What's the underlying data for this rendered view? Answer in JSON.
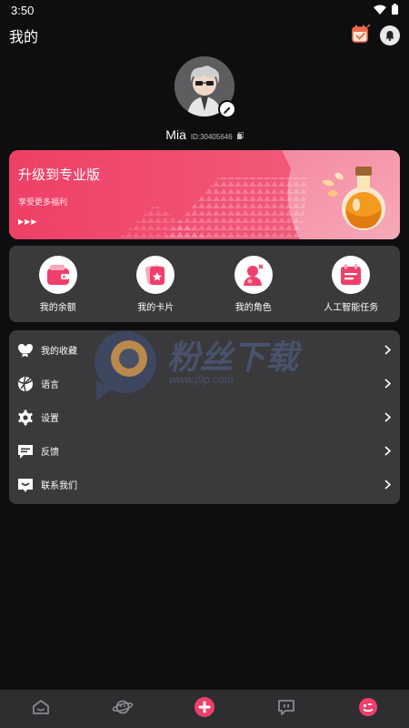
{
  "status_bar": {
    "time": "3:50"
  },
  "header": {
    "title": "我的"
  },
  "profile": {
    "name": "Mia",
    "id": "ID:30405646"
  },
  "pro_banner": {
    "title": "升级到专业版",
    "subtitle": "享受更多福利"
  },
  "quick_actions": [
    {
      "label": "我的余额",
      "icon": "wallet-icon"
    },
    {
      "label": "我的卡片",
      "icon": "card-icon"
    },
    {
      "label": "我的角色",
      "icon": "character-icon"
    },
    {
      "label": "人工智能任务",
      "icon": "calendar-task-icon"
    }
  ],
  "menu": [
    {
      "label": "我的收藏",
      "icon": "favorites-icon"
    },
    {
      "label": "语言",
      "icon": "language-icon"
    },
    {
      "label": "设置",
      "icon": "gear-icon"
    },
    {
      "label": "反馈",
      "icon": "feedback-icon"
    },
    {
      "label": "联系我们",
      "icon": "contact-icon"
    }
  ],
  "watermark": {
    "title": "粉丝下载",
    "url": "www.j9p.com"
  },
  "bottom_nav": [
    {
      "icon": "home-icon",
      "active": false
    },
    {
      "icon": "planet-icon",
      "active": false
    },
    {
      "icon": "add-icon",
      "active": false
    },
    {
      "icon": "chat-icon",
      "active": false
    },
    {
      "icon": "profile-face-icon",
      "active": true
    }
  ],
  "colors": {
    "accent": "#ef3f6a",
    "background": "#0e0e10",
    "card": "#3a3a3d",
    "nav": "#2e2e31"
  }
}
